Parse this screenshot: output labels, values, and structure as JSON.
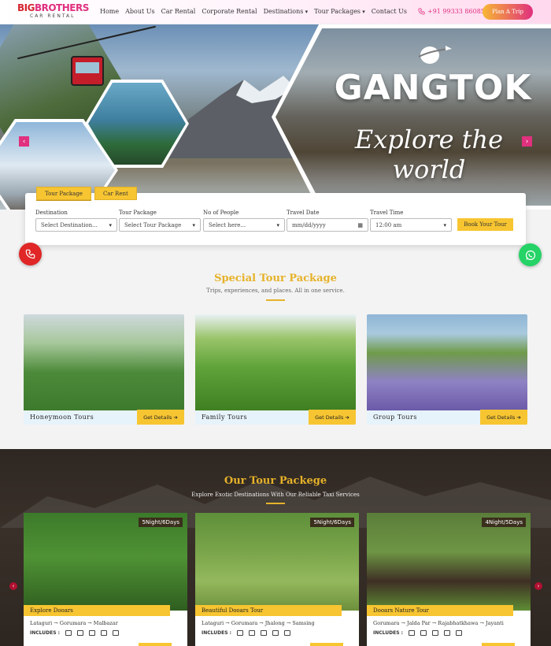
{
  "header": {
    "logo_main_a": "BIG",
    "logo_main_b": "BROTHERS",
    "logo_sub": "CAR RENTAL",
    "nav": [
      "Home",
      "About Us",
      "Car Rental",
      "Corporate Rental",
      "Destinations",
      "Tour Packages",
      "Contact Us"
    ],
    "phone": "+91 99333 86085",
    "plan_button": "Plan A Trip"
  },
  "hero": {
    "title": "GANGTOK",
    "subtitle": "Explore the world",
    "prev_icon": "‹",
    "next_icon": "›"
  },
  "booking": {
    "tabs": [
      "Tour Package",
      "Car Rent"
    ],
    "fields": [
      {
        "label": "Destination",
        "value": "Select Destination..."
      },
      {
        "label": "Tour Package",
        "value": "Select Tour Package"
      },
      {
        "label": "No of People",
        "value": "Select here..."
      },
      {
        "label": "Travel Date",
        "value": "mm/dd/yyyy"
      },
      {
        "label": "Travel Time",
        "value": "12:00 am"
      }
    ],
    "submit": "Book Your Tour"
  },
  "special": {
    "title": "Special Tour Package",
    "subtitle": "Trips, experiences, and places. All in one service.",
    "cards": [
      {
        "name": "Honeymoon Tours",
        "button": "Get Details"
      },
      {
        "name": "Family Tours",
        "button": "Get Details"
      },
      {
        "name": "Group Tours",
        "button": "Get Details"
      }
    ]
  },
  "tours": {
    "title": "Our Tour Packege",
    "subtitle": "Explore Exotic Destinations With Our Reliable Taxi Services",
    "includes_label": "INCLUDES :",
    "cards": [
      {
        "badge": "5Night/6Days",
        "name": "Explore Dooars",
        "route": "Lataguri → Gorumara → Malbazar"
      },
      {
        "badge": "5Night/6Days",
        "name": "Beautiful Dooars Tour",
        "route": "Lataguri → Gorumara → Jhalong → Samsing"
      },
      {
        "badge": "4Night/5Days",
        "name": "Dooars Nature Tour",
        "route": "Gorumara → Jalda Par → Rajabhatkhawa → Jayanti"
      }
    ]
  },
  "colors": {
    "accent_yellow": "#f7c531",
    "title_gold": "#e6b229",
    "brand_pink": "#e0307e",
    "brand_red": "#d6262f",
    "whatsapp_green": "#25d366"
  }
}
